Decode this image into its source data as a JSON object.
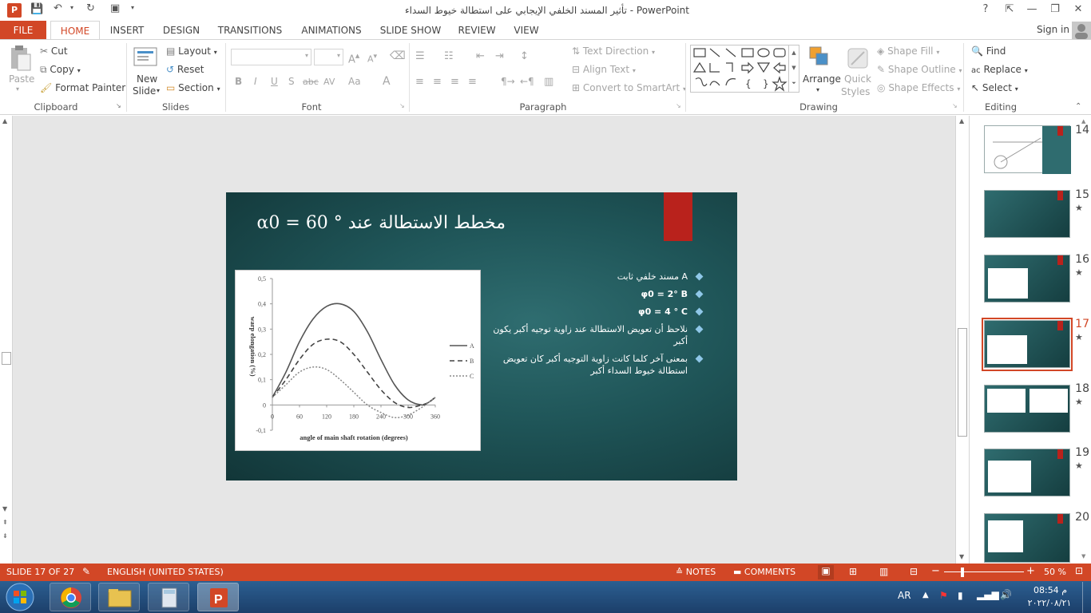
{
  "window": {
    "title": "تأثير المسند الخلفي الإيجابي على استطالة خيوط السداء - PowerPoint",
    "help": "?",
    "min": "—",
    "restore": "❐",
    "close": "✕",
    "signin": "Sign in"
  },
  "tabs": [
    "FILE",
    "HOME",
    "INSERT",
    "DESIGN",
    "TRANSITIONS",
    "ANIMATIONS",
    "SLIDE SHOW",
    "REVIEW",
    "VIEW"
  ],
  "clipboard": {
    "paste": "Paste",
    "cut": "Cut",
    "copy": "Copy",
    "format_painter": "Format Painter",
    "label": "Clipboard"
  },
  "slides_group": {
    "new_slide_1": "New",
    "new_slide_2": "Slide",
    "layout": "Layout",
    "reset": "Reset",
    "section": "Section",
    "label": "Slides"
  },
  "font_group": {
    "bold": "B",
    "italic": "I",
    "underline": "U",
    "shadow": "S",
    "strike": "abc",
    "spacing": "AV",
    "case": "Aa",
    "color": "A",
    "label": "Font"
  },
  "paragraph_group": {
    "text_direction": "Text Direction",
    "align_text": "Align Text",
    "smartart": "Convert to SmartArt",
    "label": "Paragraph"
  },
  "drawing_group": {
    "arrange": "Arrange",
    "quick_1": "Quick",
    "quick_2": "Styles",
    "shape_fill": "Shape Fill",
    "shape_outline": "Shape Outline",
    "shape_effects": "Shape Effects",
    "label": "Drawing"
  },
  "editing_group": {
    "find": "Find",
    "replace": "Replace",
    "select": "Select",
    "label": "Editing"
  },
  "slide": {
    "title": "مخطط الاستطالة عند ° 60 = α0",
    "bullets": [
      "A مسند خلفي ثابت",
      "φ0 = 2° B",
      "φ0 = 4 ° C",
      "نلاحظ أن تعويض الاستطالة عند زاوية توجيه أكبر يكون أكبر",
      "بمعنى آخر كلما كانت زاوية التوجيه أكبر كان تعويض استطالة خيوط السداء أكبر"
    ]
  },
  "chart_data": {
    "type": "line",
    "title": "",
    "xlabel": "angle of main shaft rotation (degrees)",
    "ylabel": "warp elongation (%)",
    "x_ticks": [
      "0",
      "60",
      "120",
      "180",
      "240",
      "300",
      "360"
    ],
    "y_ticks": [
      "0,5",
      "0,4",
      "0,3",
      "0,2",
      "0,1",
      "0",
      "-0,1"
    ],
    "xlim": [
      0,
      360
    ],
    "ylim": [
      -0.1,
      0.5
    ],
    "legend_position": "right",
    "series": [
      {
        "name": "A",
        "style": "solid",
        "x": [
          0,
          30,
          60,
          90,
          120,
          150,
          180,
          210,
          240,
          270,
          300,
          330,
          345,
          360
        ],
        "y": [
          0.03,
          0.13,
          0.25,
          0.34,
          0.39,
          0.4,
          0.37,
          0.29,
          0.18,
          0.08,
          0.02,
          0.0,
          0.01,
          0.03
        ]
      },
      {
        "name": "B",
        "style": "dashed",
        "x": [
          0,
          30,
          60,
          90,
          120,
          150,
          180,
          210,
          240,
          270,
          300,
          330,
          345,
          360
        ],
        "y": [
          0.03,
          0.1,
          0.18,
          0.24,
          0.26,
          0.25,
          0.2,
          0.13,
          0.06,
          0.01,
          -0.01,
          0.0,
          0.01,
          0.03
        ]
      },
      {
        "name": "C",
        "style": "dotted",
        "x": [
          0,
          30,
          60,
          90,
          120,
          150,
          180,
          210,
          240,
          270,
          300,
          330,
          345,
          360
        ],
        "y": [
          0.03,
          0.08,
          0.13,
          0.15,
          0.14,
          0.1,
          0.05,
          0.0,
          -0.03,
          -0.05,
          -0.04,
          -0.01,
          0.01,
          0.03
        ]
      }
    ]
  },
  "thumbnails": [
    {
      "num": "14",
      "star": ""
    },
    {
      "num": "15",
      "star": "★"
    },
    {
      "num": "16",
      "star": "★"
    },
    {
      "num": "17",
      "star": "★"
    },
    {
      "num": "18",
      "star": "★"
    },
    {
      "num": "19",
      "star": "★"
    },
    {
      "num": "20",
      "star": ""
    }
  ],
  "status": {
    "slide": "SLIDE 17 OF 27",
    "language": "ENGLISH (UNITED STATES)",
    "notes": "NOTES",
    "comments": "COMMENTS",
    "zoom": "50 %"
  },
  "taskbar": {
    "lang": "AR",
    "time": "08:54 م",
    "date": "٢٠٢٢/٠٨/٢١"
  },
  "colors": {
    "accent": "#d24726",
    "slide_bg": "#1f5558",
    "slide_red": "#b9221c"
  }
}
